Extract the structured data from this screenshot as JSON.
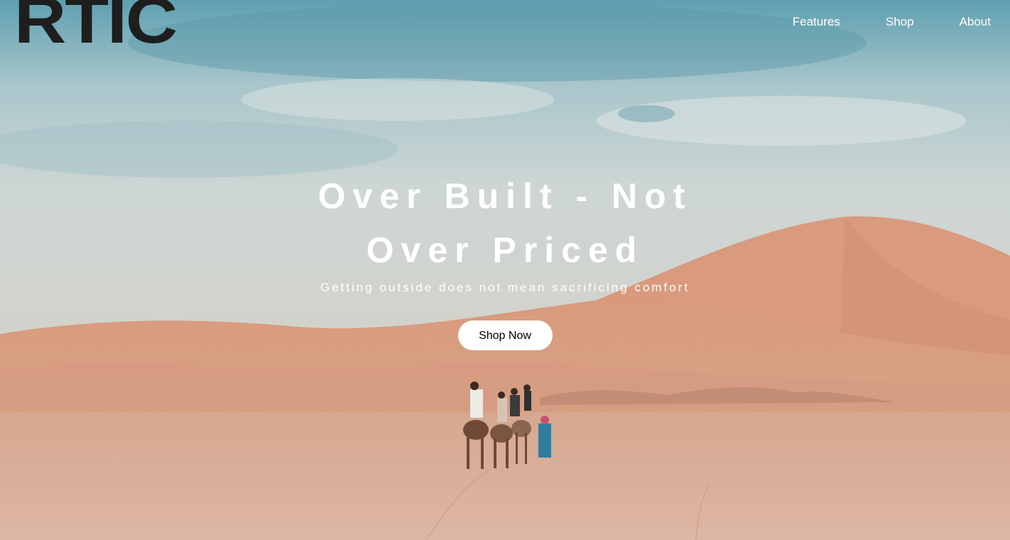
{
  "brand": {
    "logo_text": "RTIC"
  },
  "nav": {
    "items": [
      {
        "label": "Features"
      },
      {
        "label": "Shop"
      },
      {
        "label": "About"
      }
    ]
  },
  "hero": {
    "headline": "Over Built - Not Over Priced",
    "subheadline": "Getting outside does not mean sacrificing comfort",
    "cta_label": "Shop Now",
    "background_image": "desert-dunes-camel-caravan"
  },
  "colors": {
    "logo": "#1e1e1e",
    "nav_text": "#ffffff",
    "headline_text": "#ffffff",
    "cta_background": "#ffffff",
    "cta_text": "#000000",
    "sky": "#8fb9c0",
    "sand": "#dba286"
  }
}
